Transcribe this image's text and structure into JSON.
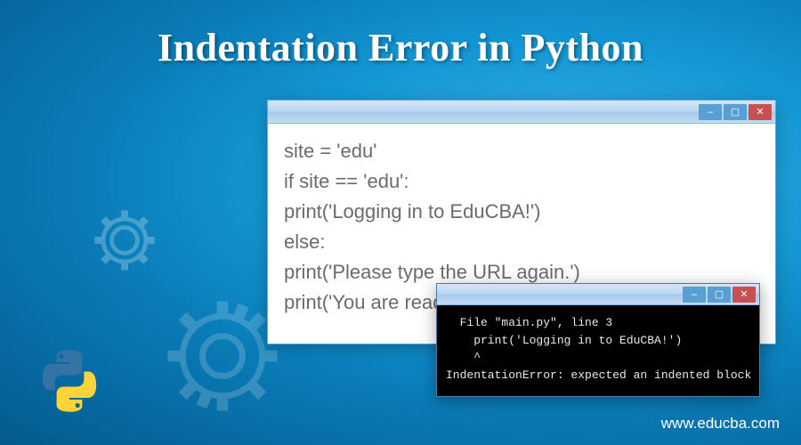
{
  "title": "Indentation Error in Python",
  "editor": {
    "lines": [
      "site = 'edu'",
      "if site == 'edu':",
      "print('Logging in to EduCBA!')",
      "else:",
      "print('Please type the URL again.')",
      "print('You are ready to go!')"
    ]
  },
  "console": {
    "lines": [
      "  File \"main.py\", line 3",
      "    print('Logging in to EduCBA!')",
      "    ^",
      "",
      "IndentationError: expected an indented block"
    ]
  },
  "watermark": "www.educba.com",
  "window_controls": {
    "min": "–",
    "max": "▢",
    "close": "✕"
  }
}
